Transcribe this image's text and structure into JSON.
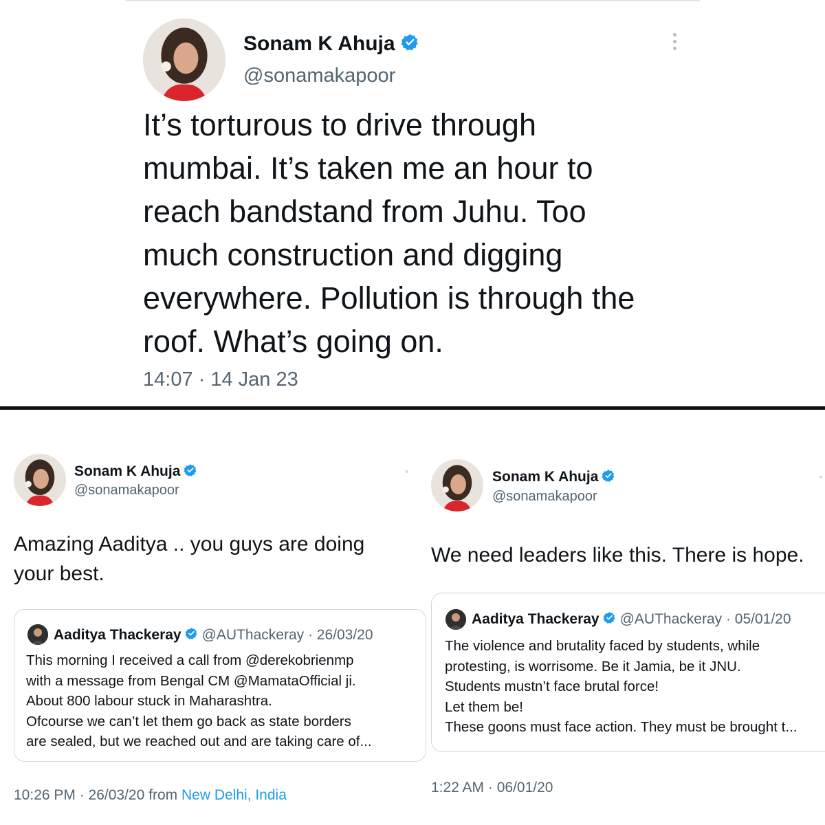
{
  "top": {
    "name": "Sonam K Ahuja",
    "handle": "@sonamakapoor",
    "lines": [
      "It’s torturous to drive through",
      "mumbai. It’s taken me an hour to",
      "reach bandstand from Juhu. Too",
      "much construction and digging",
      "everywhere. Pollution is through the",
      "roof. What’s going on."
    ],
    "time": "14:07 · 14 Jan 23"
  },
  "left": {
    "name": "Sonam K Ahuja",
    "handle": "@sonamakapoor",
    "lines": [
      "Amazing Aaditya .. you guys are doing",
      "your best."
    ],
    "quote": {
      "name": "Aaditya Thackeray",
      "meta": "@AUThackeray · 26/03/20",
      "lines": [
        "This morning I received a call from @derekobrienmp",
        "with a message from Bengal CM @MamataOfficial ji.",
        "About 800 labour stuck in Maharashtra.",
        "Ofcourse we can’t let them go back as state borders",
        "are sealed, but we reached out and are taking care of..."
      ]
    },
    "time": "10:26 PM · 26/03/20 from ",
    "location": "New Delhi, India"
  },
  "right": {
    "name": "Sonam K Ahuja",
    "handle": "@sonamakapoor",
    "lines": [
      "We need leaders like this. There is hope."
    ],
    "quote": {
      "name": "Aaditya Thackeray",
      "meta": "@AUThackeray · 05/01/20",
      "lines": [
        "The violence and brutality faced by students, while",
        "protesting, is worrisome. Be it Jamia, be it JNU.",
        "Students mustn’t face brutal force!",
        "Let them be!",
        "These goons must face action. They must be brought t..."
      ]
    },
    "time": "1:22 AM · 06/01/20"
  },
  "icons": {
    "verified": "verified-badge-icon",
    "more": "more-options-icon"
  },
  "colors": {
    "verified": "#1d9bf0",
    "link": "#1d9bf0",
    "muted": "#536471",
    "divider": "#111111"
  }
}
